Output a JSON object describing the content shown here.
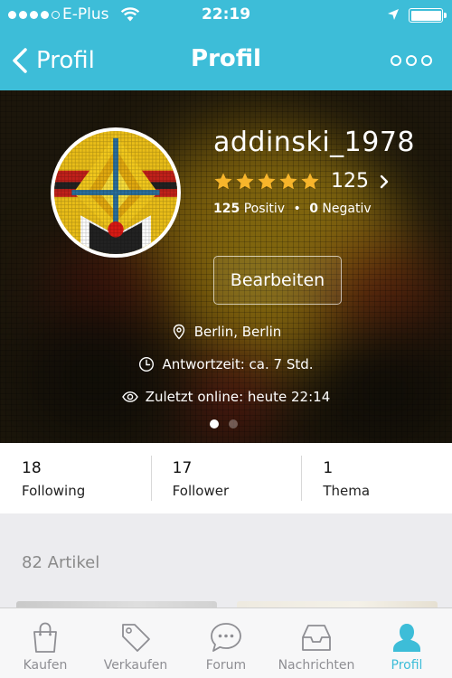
{
  "status_bar": {
    "carrier": "E-Plus",
    "time": "22:19",
    "signal_bars_filled": 4,
    "signal_bars_total": 5,
    "icons": [
      "signal-dots-icon",
      "wifi-icon",
      "location-arrow-icon",
      "battery-icon"
    ]
  },
  "nav": {
    "back_label": "Profil",
    "title": "Profil",
    "more_icon": "more-dots-icon"
  },
  "profile": {
    "username": "addinski_1978",
    "stars": 5,
    "rating_count": "125",
    "positive_count": "125",
    "positive_label": "Positiv",
    "negative_count": "0",
    "negative_label": "Negativ",
    "separator": "•",
    "edit_label": "Bearbeiten",
    "location": "Berlin, Berlin",
    "response_time": "Antwortzeit: ca. 7 Std.",
    "last_online": "Zuletzt online: heute 22:14",
    "pages_total": 2,
    "page_active": 1
  },
  "stats": [
    {
      "value": "18",
      "label": "Following"
    },
    {
      "value": "17",
      "label": "Follower"
    },
    {
      "value": "1",
      "label": "Thema"
    }
  ],
  "articles": {
    "title": "82 Artikel"
  },
  "tabs": [
    {
      "label": "Kaufen",
      "icon": "shopping-bag-icon",
      "active": false
    },
    {
      "label": "Verkaufen",
      "icon": "price-tag-icon",
      "active": false
    },
    {
      "label": "Forum",
      "icon": "chat-bubble-icon",
      "active": false
    },
    {
      "label": "Nachrichten",
      "icon": "inbox-tray-icon",
      "active": false
    },
    {
      "label": "Profil",
      "icon": "person-icon",
      "active": true
    }
  ],
  "colors": {
    "accent": "#3dbdd8",
    "star": "#f7b52b",
    "tab_inactive": "#8e8e93"
  }
}
